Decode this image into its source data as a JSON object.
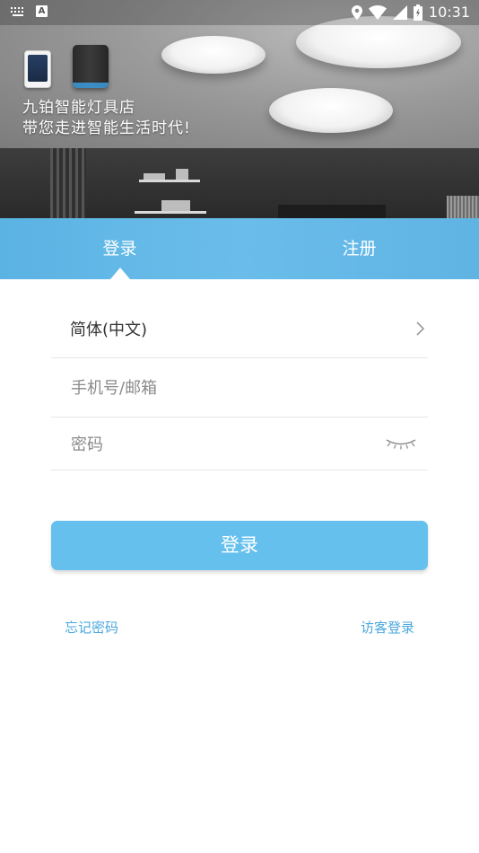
{
  "status_bar": {
    "time": "10:31",
    "icons": [
      "keyboard-icon",
      "a-icon",
      "location-icon",
      "wifi-icon",
      "signal-icon",
      "battery-icon"
    ]
  },
  "hero": {
    "title": "九铂智能灯具店",
    "subtitle": "带您走进智能生活时代!"
  },
  "tabs": [
    {
      "label": "登录",
      "active": true
    },
    {
      "label": "注册",
      "active": false
    }
  ],
  "form": {
    "language_value": "简体(中文)",
    "phone_placeholder": "手机号/邮箱",
    "password_placeholder": "密码"
  },
  "login_button": "登录",
  "links": {
    "forgot_password": "忘记密码",
    "guest_login": "访客登录"
  },
  "colors": {
    "accent": "#66c0ed",
    "tab_bar": "#62b8e6",
    "link": "#4aa8de"
  }
}
